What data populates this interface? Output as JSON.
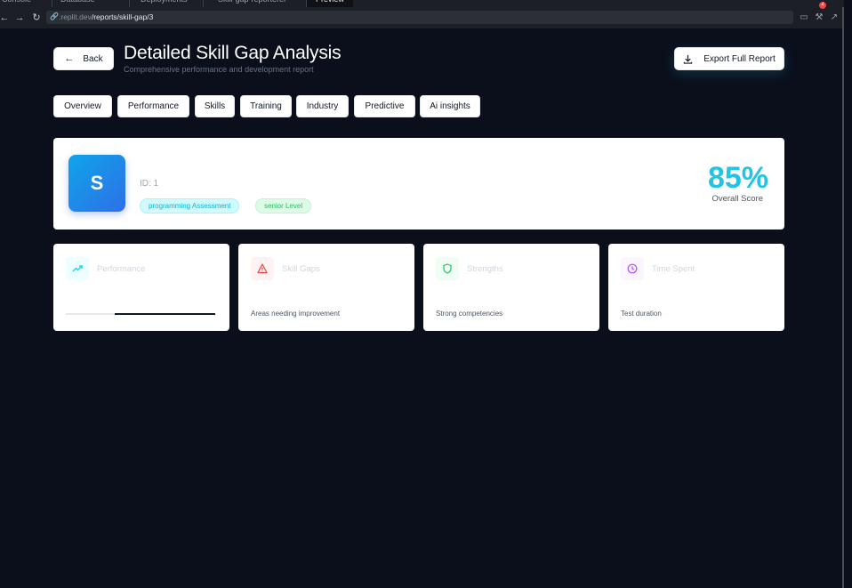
{
  "browser": {
    "tabs": [
      "Console",
      "Database",
      "Deployments",
      "Skill-gap-reporterer",
      "Preview"
    ],
    "url_host": ".replit.dev",
    "url_path": "/reports/skill-gap/3",
    "notification_count": "4"
  },
  "header": {
    "back_label": "Back",
    "title": "Detailed Skill Gap Analysis",
    "subtitle": "Comprehensive performance and development report",
    "export_label": "Export Full Report"
  },
  "tabs": [
    {
      "label": "Overview"
    },
    {
      "label": "Performance"
    },
    {
      "label": "Skills"
    },
    {
      "label": "Training"
    },
    {
      "label": "Industry"
    },
    {
      "label": "Predictive"
    },
    {
      "label": "Ai insights"
    }
  ],
  "profile": {
    "avatar_letter": "S",
    "id_text": "ID: 1",
    "assessment_chip": "programming Assessment",
    "level_chip": "senior Level",
    "score": "85%",
    "score_label": "Overall Score"
  },
  "metrics": [
    {
      "title": "Performance",
      "icon": "trending-up-icon",
      "progress_fraction": 0.67,
      "icon_color": "#22d3ee",
      "icon_bg": "#ecfeff"
    },
    {
      "title": "Skill Gaps",
      "icon": "warning-icon",
      "desc": "Areas needing improvement",
      "icon_color": "#ef4444",
      "icon_bg": "#fef2f2"
    },
    {
      "title": "Strengths",
      "icon": "shield-icon",
      "desc": "Strong competencies",
      "icon_color": "#22c55e",
      "icon_bg": "#f0fdf4"
    },
    {
      "title": "Time Spent",
      "icon": "clock-icon",
      "desc": "Test duration",
      "icon_color": "#a855f7",
      "icon_bg": "#faf5ff"
    }
  ]
}
